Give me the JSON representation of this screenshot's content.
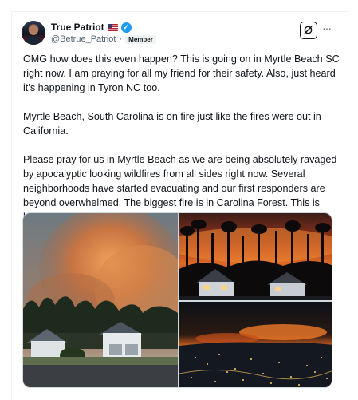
{
  "author": {
    "name": "True Patriot",
    "flag_icon": "us-flag-icon",
    "verified_icon": "verified-badge-icon",
    "verified_mark": "✓",
    "handle": "@Betrue_Patriot",
    "separator": "·",
    "badge": "Member"
  },
  "actions": {
    "grok_icon": "grok-icon",
    "more_label": "···"
  },
  "tweet": {
    "paragraph_1": "OMG how does this even happen? This is going on in Myrtle Beach SC right now. I am praying for all my friend for their safety. Also, just heard it’s happening in Tyron NC too.",
    "paragraph_2": "Myrtle Beach, South Carolina is on fire just like the fires were out in California.",
    "paragraph_3": "Please pray for us in Myrtle Beach as we are being absolutely ravaged by apocalyptic looking wildfires from all sides right now. Several neighborhoods have started evacuating and our first responders are beyond overwhelmed. The biggest fire is in Carolina Forest. This is horrific and terrifying. Please pray for us."
  },
  "media": [
    {
      "name": "photo-smoke-over-houses"
    },
    {
      "name": "photo-fire-behind-trees"
    },
    {
      "name": "photo-aerial-night-fire"
    }
  ],
  "colors": {
    "accent": "#1d9bf0",
    "text": "#0f1419",
    "secondary_text": "#536471"
  }
}
